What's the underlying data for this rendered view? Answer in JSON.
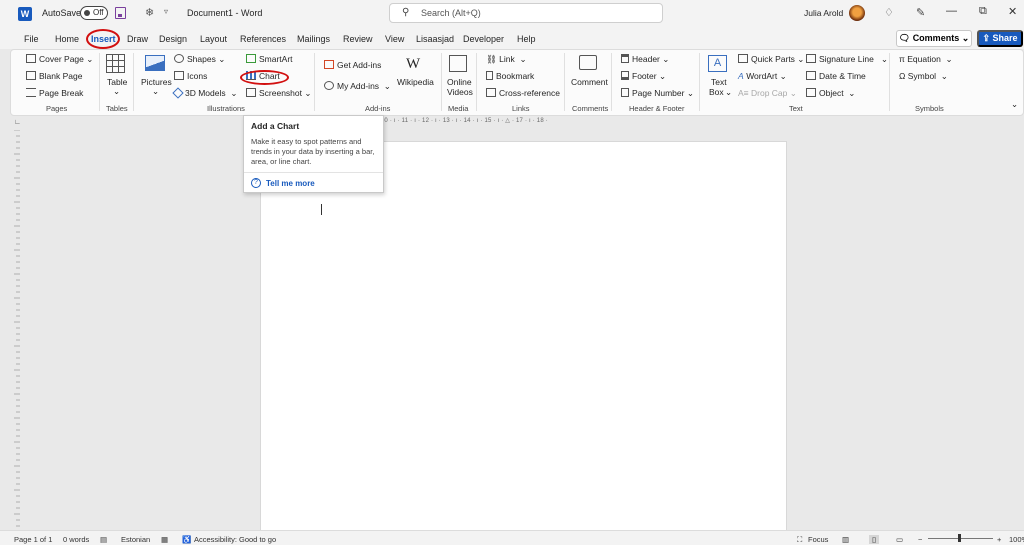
{
  "titlebar": {
    "autosave_label": "AutoSave",
    "autosave_state": "Off",
    "document_title": "Document1  -  Word",
    "search_placeholder": "Search (Alt+Q)",
    "user_name": "Julia Arold"
  },
  "tabs": [
    "File",
    "Home",
    "Insert",
    "Draw",
    "Design",
    "Layout",
    "References",
    "Mailings",
    "Review",
    "View",
    "Lisaasjad",
    "Developer",
    "Help"
  ],
  "active_tab": "Insert",
  "top_right": {
    "comments_label": "Comments",
    "share_label": "Share"
  },
  "ribbon": {
    "pages": {
      "cover_page": "Cover Page",
      "blank_page": "Blank Page",
      "page_break": "Page Break",
      "group": "Pages"
    },
    "tables": {
      "table": "Table",
      "group": "Tables"
    },
    "illustrations": {
      "pictures": "Pictures",
      "shapes": "Shapes",
      "icons": "Icons",
      "models3d": "3D Models",
      "smartart": "SmartArt",
      "chart": "Chart",
      "screenshot": "Screenshot",
      "group": "Illustrations"
    },
    "addins": {
      "get_addins": "Get Add-ins",
      "my_addins": "My Add-ins",
      "wikipedia": "Wikipedia",
      "group": "Add-ins"
    },
    "media": {
      "online_videos_1": "Online",
      "online_videos_2": "Videos",
      "group": "Media"
    },
    "links": {
      "link": "Link",
      "bookmark": "Bookmark",
      "cross_reference": "Cross-reference",
      "group": "Links"
    },
    "comments": {
      "comment": "Comment",
      "group": "Comments"
    },
    "header_footer": {
      "header": "Header",
      "footer": "Footer",
      "page_number": "Page Number",
      "group": "Header & Footer"
    },
    "text": {
      "text_box_1": "Text",
      "text_box_2": "Box",
      "quick_parts": "Quick Parts",
      "wordart": "WordArt",
      "drop_cap": "Drop Cap",
      "signature_line": "Signature Line",
      "date_time": "Date & Time",
      "object": "Object",
      "group": "Text"
    },
    "symbols": {
      "equation": "Equation",
      "symbol": "Symbol",
      "group": "Symbols"
    }
  },
  "tooltip": {
    "title": "Add a Chart",
    "description": "Make it easy to spot patterns and trends in your data by inserting a bar, area, or line chart.",
    "link": "Tell me more"
  },
  "ruler_text": "3 · ı · 4 · ı · 5 · ı · 6 · ı · 7 · ı · 8 · ı · 9 · ı · 10 · ı · 11 · ı · 12 · ı · 13 · ı · 14 · ı · 15 · ı · △ · 17 · ı · 18 ·",
  "statusbar": {
    "page": "Page 1 of 1",
    "words": "0 words",
    "language": "Estonian",
    "accessibility": "Accessibility: Good to go",
    "focus": "Focus",
    "zoom": "100%"
  }
}
